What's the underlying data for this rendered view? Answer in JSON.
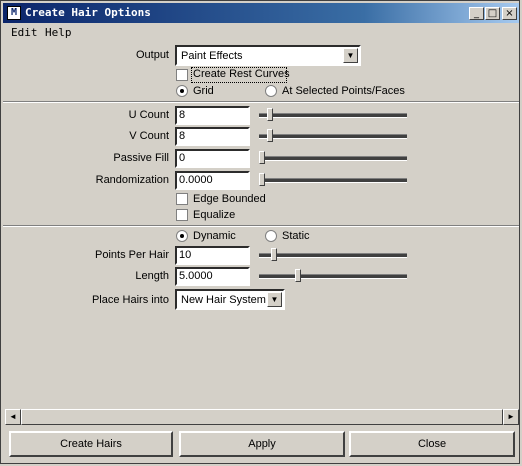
{
  "window": {
    "title": "Create Hair Options",
    "min": "_",
    "max": "□",
    "close": "×"
  },
  "menu": [
    "Edit",
    "Help"
  ],
  "output": {
    "label": "Output",
    "value": "Paint Effects",
    "create_rest_curves": "Create Rest Curves",
    "create_rest_checked": false
  },
  "placement": {
    "option1": "Grid",
    "option2": "At Selected Points/Faces",
    "selected": "Grid"
  },
  "grid": {
    "u_count": {
      "label": "U Count",
      "value": "8",
      "slider": 0.05
    },
    "v_count": {
      "label": "V Count",
      "value": "8",
      "slider": 0.05
    },
    "passive_fill": {
      "label": "Passive Fill",
      "value": "0",
      "slider": 0.0
    },
    "randomization": {
      "label": "Randomization",
      "value": "0.0000",
      "slider": 0.0
    },
    "edge_bounded": {
      "label": "Edge Bounded",
      "checked": false
    },
    "equalize": {
      "label": "Equalize",
      "checked": false
    }
  },
  "dynamics": {
    "option1": "Dynamic",
    "option2": "Static",
    "selected": "Dynamic"
  },
  "points_per_hair": {
    "label": "Points Per Hair",
    "value": "10",
    "slider": 0.05
  },
  "length": {
    "label": "Length",
    "value": "5.0000",
    "slider": 0.25
  },
  "place_hairs": {
    "label": "Place Hairs into",
    "value": "New Hair System"
  },
  "buttons": {
    "create": "Create Hairs",
    "apply": "Apply",
    "close": "Close"
  },
  "scroll": {
    "left": "◄",
    "right": "►"
  },
  "arrow": "▼"
}
